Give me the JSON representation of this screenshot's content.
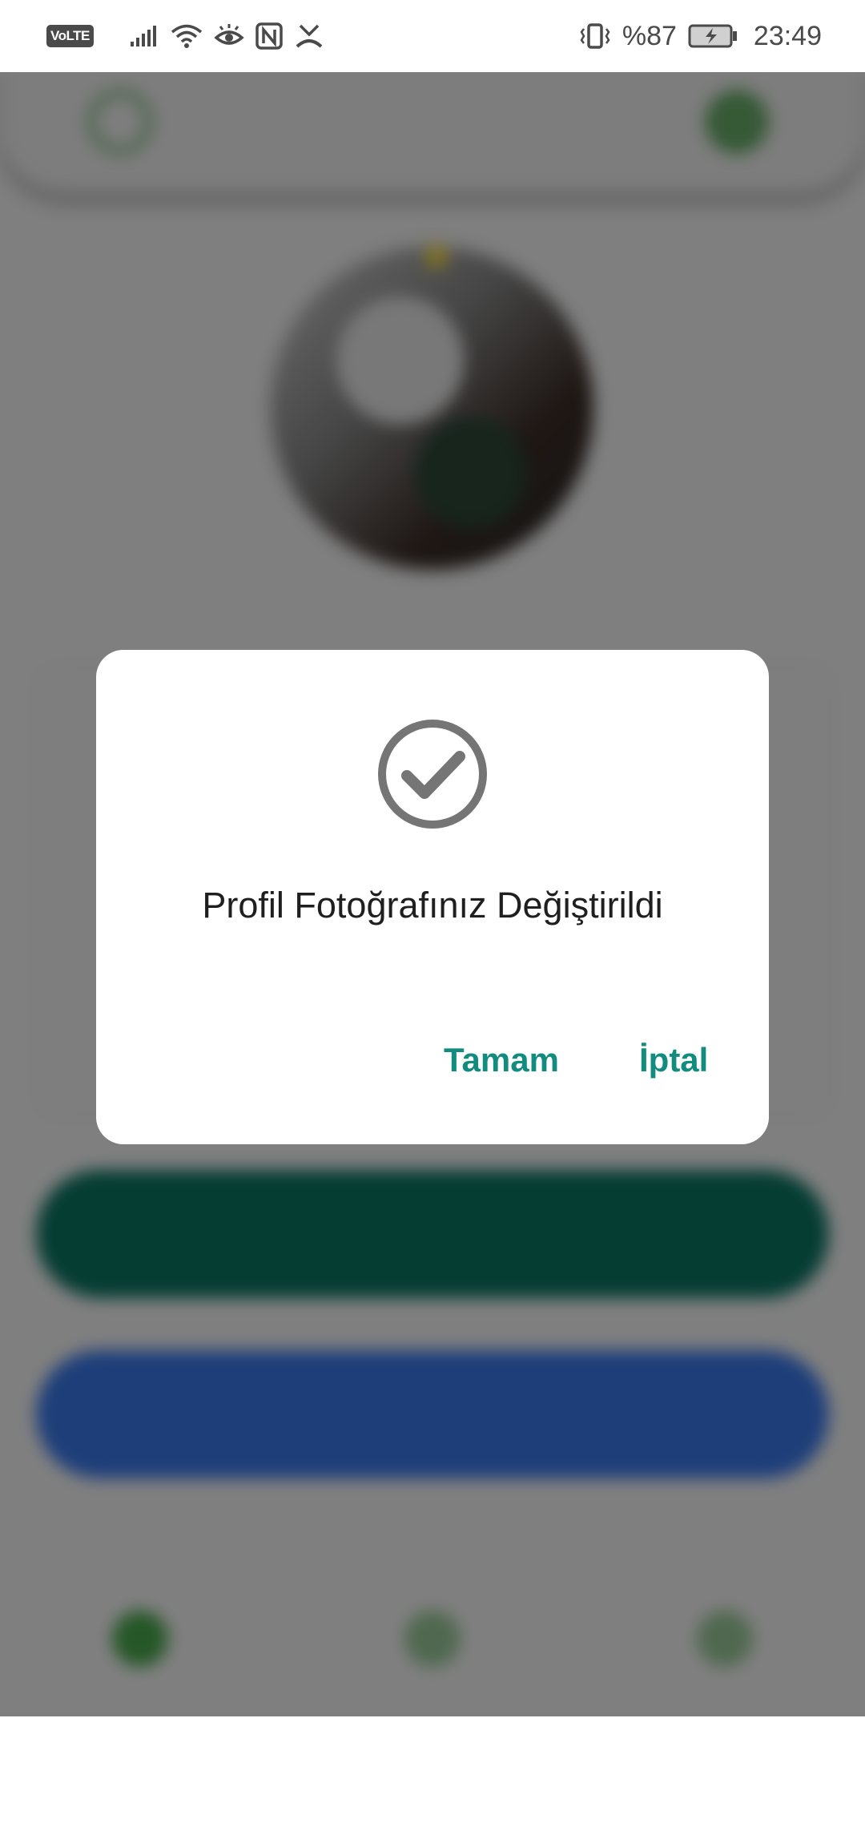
{
  "status_bar": {
    "volte_label": "VoLTE",
    "battery_percent": "%87",
    "time": "23:49",
    "icons": [
      "signal-icon",
      "wifi-icon",
      "eye-comfort-icon",
      "nfc-icon",
      "missed-call-icon",
      "vibrate-icon",
      "battery-charging-icon"
    ]
  },
  "dialog": {
    "icon": "check-circle-icon",
    "message": "Profil Fotoğrafınız Değiştirildi",
    "ok_label": "Tamam",
    "cancel_label": "İptal"
  },
  "colors": {
    "accent": "#128c7e",
    "check_icon": "#757575",
    "scrim": "rgba(0,0,0,0.5)"
  }
}
